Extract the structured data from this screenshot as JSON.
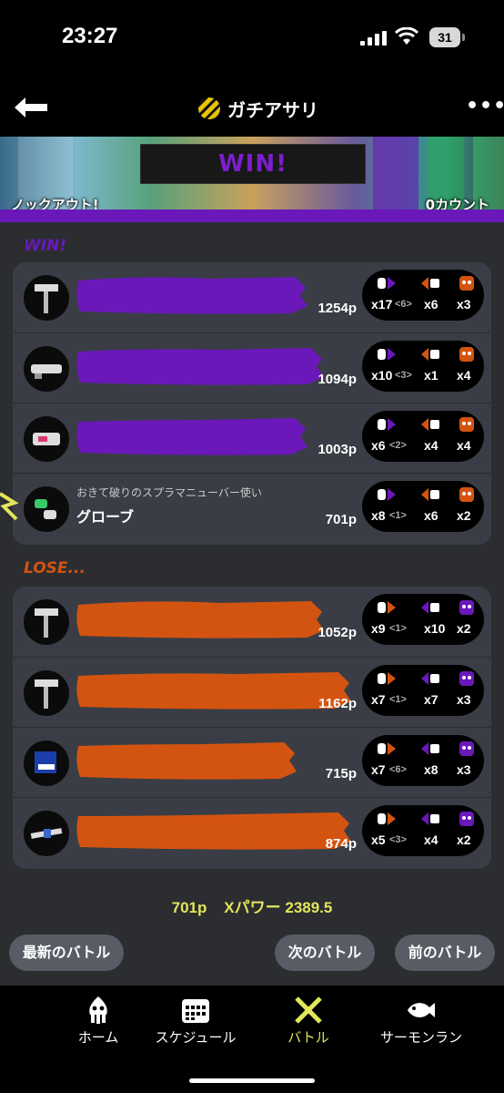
{
  "status": {
    "time": "23:27",
    "battery": "31"
  },
  "nav": {
    "title": "ガチアサリ"
  },
  "banner": {
    "result": "WIN!",
    "left_label": "ノックアウト!",
    "right_label": "0カウント"
  },
  "teams": [
    {
      "label": "WIN!",
      "color": "#6a18ba",
      "players": [
        {
          "points": "1254p",
          "kills": "x17",
          "assists": "<6>",
          "specials": "x6",
          "deaths": "x3",
          "paint_level": 0.42
        },
        {
          "points": "1094p",
          "kills": "x10",
          "assists": "<3>",
          "specials": "x1",
          "deaths": "x4",
          "paint_level": 0.45
        },
        {
          "points": "1003p",
          "kills": "x6",
          "assists": "<2>",
          "specials": "x4",
          "deaths": "x4",
          "paint_level": 0.42
        },
        {
          "points": "701p",
          "kills": "x8",
          "assists": "<1>",
          "specials": "x6",
          "deaths": "x2",
          "title": "おきて破りのスプラマニューバー使い",
          "name": "グローブ",
          "self": true
        }
      ]
    },
    {
      "label": "LOSE...",
      "color": "#d35410",
      "players": [
        {
          "points": "1052p",
          "kills": "x9",
          "assists": "<1>",
          "specials": "x10",
          "deaths": "x2",
          "paint_level": 0.45
        },
        {
          "points": "1162p",
          "kills": "x7",
          "assists": "<1>",
          "specials": "x7",
          "deaths": "x3",
          "paint_level": 0.5
        },
        {
          "points": "715p",
          "kills": "x7",
          "assists": "<6>",
          "specials": "x8",
          "deaths": "x3",
          "paint_level": 0.4
        },
        {
          "points": "874p",
          "kills": "x5",
          "assists": "<3>",
          "specials": "x4",
          "deaths": "x2",
          "paint_level": 0.5
        }
      ]
    }
  ],
  "summary": {
    "points": "701p",
    "xpower": "Xパワー 2389.5"
  },
  "buttons": {
    "latest": "最新のバトル",
    "next": "次のバトル",
    "prev": "前のバトル"
  },
  "tabs": [
    {
      "label": "ホーム",
      "icon": "squid-icon",
      "active": false
    },
    {
      "label": "スケジュール",
      "icon": "calendar-icon",
      "active": false
    },
    {
      "label": "バトル",
      "icon": "battle-icon",
      "active": true
    },
    {
      "label": "サーモンラン",
      "icon": "salmon-icon",
      "active": false
    }
  ],
  "colors": {
    "win": "#6a18ba",
    "lose": "#d35410",
    "accent": "#e3e55a"
  }
}
